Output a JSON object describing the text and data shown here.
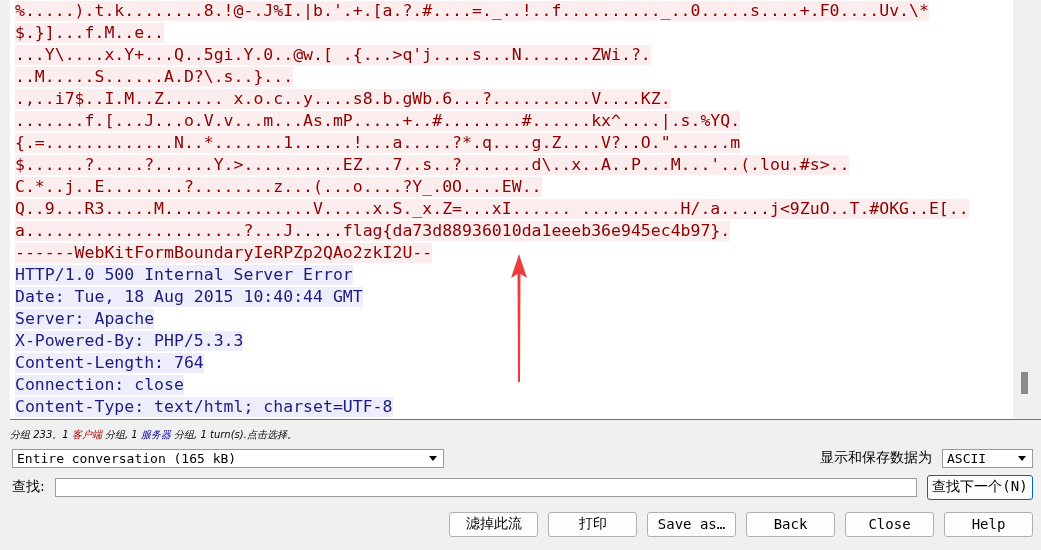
{
  "stream": {
    "lines": [
      {
        "kind": "client",
        "text": "%.....).t.k........8.!@-.J%I.|b.'.+.[a.?.#....=._..!..f.........._..0.....s....+.F0....Uv.\\*"
      },
      {
        "kind": "client",
        "text": "$.}]...f.M..e.."
      },
      {
        "kind": "client",
        "text": "...Y\\....x.Y+...Q..5gi.Y.0..@w.[ .{...>q'j....s...N.......ZWi.?."
      },
      {
        "kind": "client",
        "text": "..M.....S......A.D?\\.s..}..."
      },
      {
        "kind": "client",
        "text": ".,..i7$..I.M..Z...... x.o.c..y....s8.b.gWb.6...?..........V....KZ."
      },
      {
        "kind": "client",
        "text": ".......f.[...J...o.V.v...m...As.mP.....+..#........#......kx^....|.s.%YQ."
      },
      {
        "kind": "client",
        "text": "{.=.............N..*.......1......!...a.....?*.q....g.Z....V?..O.\"......m"
      },
      {
        "kind": "client",
        "text": "$......?.....?......Y.>..........EZ...7..s..?.......d\\..x..A..P...M...'..(.lou.#s>.."
      },
      {
        "kind": "client",
        "text": "C.*..j..E........?........z...(...o....?Y_.0O....EW.."
      },
      {
        "kind": "client",
        "text": "Q..9...R3.....M...............V.....x.S._x.Z=...xI...... ..........H/.a.....j<9ZuO..T.#OKG..E[.."
      },
      {
        "kind": "client",
        "text": "a......................?...J.....flag{da73d88936010da1eeeb36e945ec4b97}."
      },
      {
        "kind": "client",
        "text": "------WebKitFormBoundaryIeRPZp2QAo2zkI2U--"
      },
      {
        "kind": "server",
        "text": "HTTP/1.0 500 Internal Server Error"
      },
      {
        "kind": "server",
        "text": "Date: Tue, 18 Aug 2015 10:40:44 GMT"
      },
      {
        "kind": "server",
        "text": "Server: Apache"
      },
      {
        "kind": "server",
        "text": "X-Powered-By: PHP/5.3.3"
      },
      {
        "kind": "server",
        "text": "Content-Length: 764"
      },
      {
        "kind": "server",
        "text": "Connection: close"
      },
      {
        "kind": "server",
        "text": "Content-Type: text/html; charset=UTF-8"
      }
    ]
  },
  "status": [
    {
      "kind": "plain",
      "text": "分组 233。1 "
    },
    {
      "kind": "client",
      "text": "客户端"
    },
    {
      "kind": "plain",
      "text": " 分组, 1 "
    },
    {
      "kind": "server",
      "text": "服务器"
    },
    {
      "kind": "plain",
      "text": " 分组, 1 turn(s).点击选择。"
    }
  ],
  "conversation_select": {
    "value": "Entire conversation (165 kB)"
  },
  "format_label": "显示和保存数据为",
  "format_select": {
    "value": "ASCII"
  },
  "find": {
    "label": "查找:",
    "button": "查找下一个(N)"
  },
  "buttons": [
    "滤掉此流",
    "打印",
    "Save as…",
    "Back",
    "Close",
    "Help"
  ]
}
